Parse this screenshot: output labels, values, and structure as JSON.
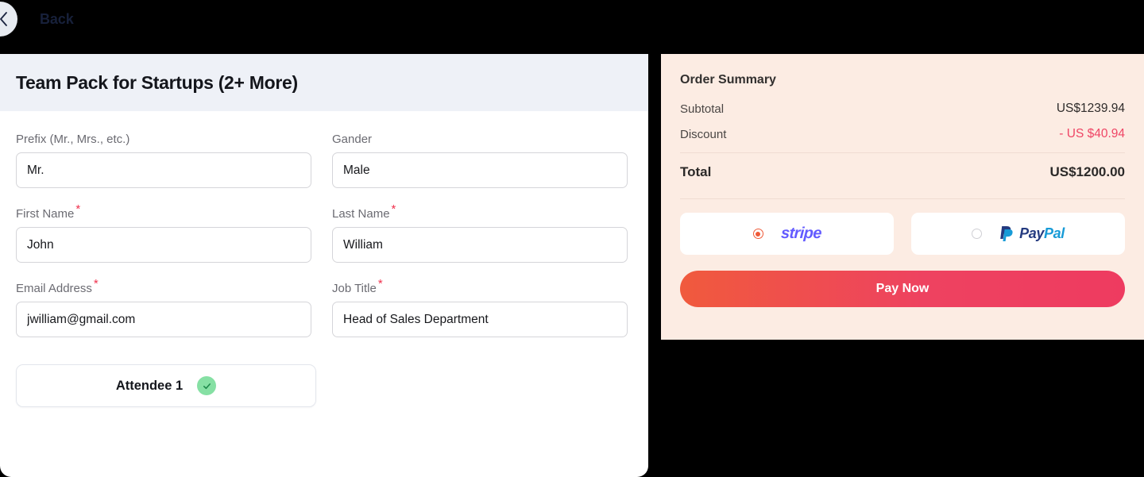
{
  "topbar": {
    "back_label": "Back",
    "back_icon": "chevron-left-icon"
  },
  "form": {
    "title": "Team Pack for Startups (2+ More)",
    "fields": [
      {
        "label": "Prefix (Mr., Mrs., etc.)",
        "value": "Mr.",
        "required": false
      },
      {
        "label": "Gander",
        "value": "Male",
        "required": false
      },
      {
        "label": "First Name",
        "value": "John",
        "required": true
      },
      {
        "label": "Last Name",
        "value": "William",
        "required": true
      },
      {
        "label": "Email Address",
        "value": "jwilliam@gmail.com",
        "required": true
      },
      {
        "label": "Job Title",
        "value": "Head of Sales Department",
        "required": true
      }
    ],
    "required_marker": "*",
    "attendee": {
      "label": "Attendee 1",
      "status_icon": "check-circle-icon",
      "status_color": "#86e0a4"
    }
  },
  "summary": {
    "title": "Order Summary",
    "rows": [
      {
        "label": "Subtotal",
        "value": "US$1239.94"
      },
      {
        "label": "Discount",
        "value": "- US $40.94"
      }
    ],
    "discount_color": "#ef4565",
    "total_label": "Total",
    "total_value": "US$1200.00",
    "payment_methods": [
      {
        "name": "stripe",
        "label": "stripe",
        "selected": true
      },
      {
        "name": "paypal",
        "label_dark": "Pay",
        "label_light": "Pal",
        "selected": false
      }
    ],
    "pay_button_label": "Pay Now",
    "panel_color": "#fcece3",
    "accent_color": "#ee4260"
  }
}
